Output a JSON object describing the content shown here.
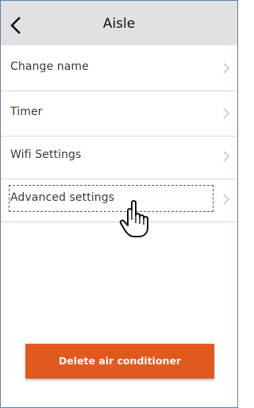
{
  "header": {
    "title": "Aisle",
    "back_icon": "chevron-left-icon"
  },
  "menu": {
    "items": [
      {
        "label": "Change name",
        "icon": "chevron-right-icon"
      },
      {
        "label": "Timer",
        "icon": "chevron-right-icon"
      },
      {
        "label": "Wifi Settings",
        "icon": "chevron-right-icon"
      },
      {
        "label": "Advanced settings",
        "icon": "chevron-right-icon",
        "focused": true
      }
    ]
  },
  "cursor": {
    "icon": "hand-pointer-icon"
  },
  "actions": {
    "delete_label": "Delete air conditioner"
  },
  "colors": {
    "header_bg": "#e1e1e1",
    "delete_button": "#e05a1f",
    "frame_border": "#5a83b5"
  }
}
